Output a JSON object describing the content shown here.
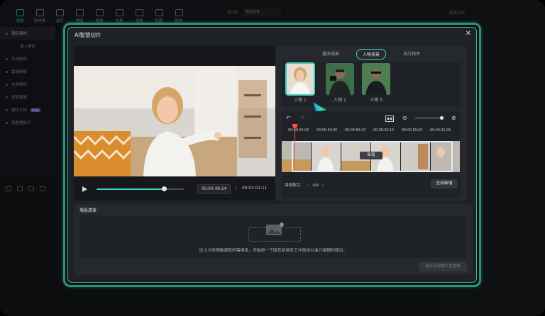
{
  "colors": {
    "accent": "#3fd2bb",
    "glow": "#2e8f7b",
    "playhead": "#ff4d4d"
  },
  "toolbar": {
    "items": [
      {
        "label": "媒體",
        "icon": "media-icon"
      },
      {
        "label": "素材庫",
        "icon": "store-icon"
      },
      {
        "label": "音訊",
        "icon": "audio-icon"
      },
      {
        "label": "標題",
        "icon": "title-icon"
      },
      {
        "label": "轉場",
        "icon": "transition-icon"
      },
      {
        "label": "效果",
        "icon": "effects-icon"
      },
      {
        "label": "濾鏡",
        "icon": "filter-icon"
      },
      {
        "label": "貼圖",
        "icon": "sticker-icon"
      },
      {
        "label": "範本",
        "icon": "template-icon"
      }
    ]
  },
  "sidebar": {
    "items": [
      {
        "label": "項目素材"
      },
      {
        "label": "導入素材"
      },
      {
        "label": "本地素材"
      },
      {
        "label": "雲端硬碟"
      },
      {
        "label": "在線素材"
      },
      {
        "label": "調整圖層"
      },
      {
        "label": "優化片段",
        "badge": "NEW"
      },
      {
        "label": "調整檔影片"
      }
    ]
  },
  "bg": {
    "mid_label": "播放器",
    "mid_select": "最高品質",
    "right_label": "檔案資訊"
  },
  "dialog": {
    "title": "AI智慧切片",
    "close": "✕",
    "player": {
      "current_time": "00:00:49:24",
      "separator": "/",
      "total_time": "00:01:01:11",
      "progress": 0.78
    },
    "tabs": [
      "畫面場景",
      "人物場景",
      "自訂物件"
    ],
    "selected_tab": 1,
    "persons": [
      {
        "label": "人物 1",
        "selected": true
      },
      {
        "label": "人物 2",
        "selected": false
      },
      {
        "label": "人物 3",
        "selected": false
      }
    ],
    "ruler": [
      "00:00:50:00",
      "00:00:50:05",
      "00:00:50:10",
      "00:00:50:15",
      "00:00:50:20",
      "00:00:51:00"
    ],
    "add_tag": "新增",
    "scene_count_label": "場景數目：",
    "scene_count": "4/8",
    "add_all": "全部新增",
    "list_title": "場景清單",
    "hint": "從上方時間軸選取所需場景，然後按一下將其新增至工作區域以進行編輯和匯出。",
    "export": "儲存至媒體中並繼續"
  }
}
